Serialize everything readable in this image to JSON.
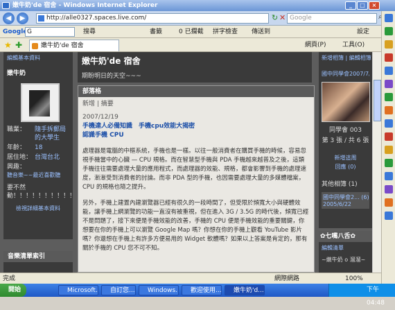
{
  "window": {
    "title": "嫩牛奶'de 宿舍 - Windows Internet Explorer"
  },
  "address": {
    "url": "http://alle0327.spaces.live.com/",
    "search_placeholder": "Google"
  },
  "google_bar": {
    "logo": "Google",
    "search_label": "G",
    "items": [
      "搜尋",
      "書籤",
      "0 已攔截",
      "拼字檢查",
      "傳送到"
    ],
    "settings": "設定"
  },
  "toolbar": {
    "tab_title": "嫩牛奶'de 宿舍",
    "page_menu": "網頁(P)",
    "tools_menu": "工具(O)"
  },
  "left": {
    "edit_label": "編輯基本資料",
    "name": "嫩牛奶",
    "profile": [
      {
        "k": "職業：",
        "v": "隨手拆郵局的大學生"
      },
      {
        "k": "年齡：",
        "v": "18"
      },
      {
        "k": "居住地：",
        "v": "台灣台北"
      },
      {
        "k": "興趣：",
        "v": ""
      }
    ],
    "interest_text": "聽音樂~~最近喜歡聽",
    "quote": "要不然動！！！！！！！！！！",
    "edit_more": "檢視詳細基本資料",
    "music_title": "音樂清單索引"
  },
  "header": {
    "title": "嫩牛奶'de 宿舍",
    "subtitle": "期盼明日的天空~~~"
  },
  "blog": {
    "section": "部落格",
    "new_label": "新增",
    "summary_label": "摘要",
    "date": "2007/12/19",
    "post_title1": "手機達人必備知識　手機cpu效能大揭密",
    "post_title2": "認識手機 CPU",
    "para1": "處理器是電腦的中樞系統，手機也是一樣。以往一般消費者在購買手機的時候，容易忽視手機當中的心臟 — CPU 規格。而在智慧型手機與 PDA 手機越來越普及之後，這類手機往往需要處理大量的應用程式，而處理器的效能、規格，都會影響到手機的處理速度，漸漸受到消費者的討論。而非 PDA 型的手機，也因需要處理大量的多媒體檔案，CPU 的規格也隨之提升。",
    "para2": "另外，手機上建置內建瀏覽器已經有很久的一段時間了，但受限於頻寬大小與硬體效能，讓手機上網瀏覽的功能一直沒有被重視，但在進入 3G / 3.5G 的時代後，頻寬已經不是問題了，接下來便是手機效能的改善，手機的 CPU 便是手機效能的重要關鍵，你想要在你的手機上可以瀏覽 Google Map 嗎？你想在你的手機上觀看 YouTube 影片嗎？你還想在手機上有許多方便易用的 Widget 軟體嗎？如果以上答案是肯定的，那有關於手機的 CPU 您不可不知。"
  },
  "right": {
    "top_links": [
      "新增相簿",
      "編輯相簿"
    ],
    "album_name": "國中同學會2007/7/9",
    "photo_caption": "同學會 003",
    "pager": "第 3 張 / 共 6 張",
    "new_photos": "新增這周",
    "back": "回應 (0)",
    "other_albums": "其他相簿 (1)",
    "album2": "國中同學會2... (6)",
    "album2_date": "2005/6/22",
    "friends_title": "✿七嘴八舌✿",
    "friends_link": "編輯清單",
    "friends_line": "~嫩牛奶 o 溜溜~"
  },
  "status": {
    "left": "完成",
    "zone": "網際網路",
    "zoom": "100%"
  },
  "taskbar": {
    "start": "開始",
    "tasks": [
      "Microsoft...",
      "自訂您...",
      "Windows...",
      "歡迎使用...",
      "嫩牛奶'd..."
    ],
    "time": "下午 04:48"
  }
}
